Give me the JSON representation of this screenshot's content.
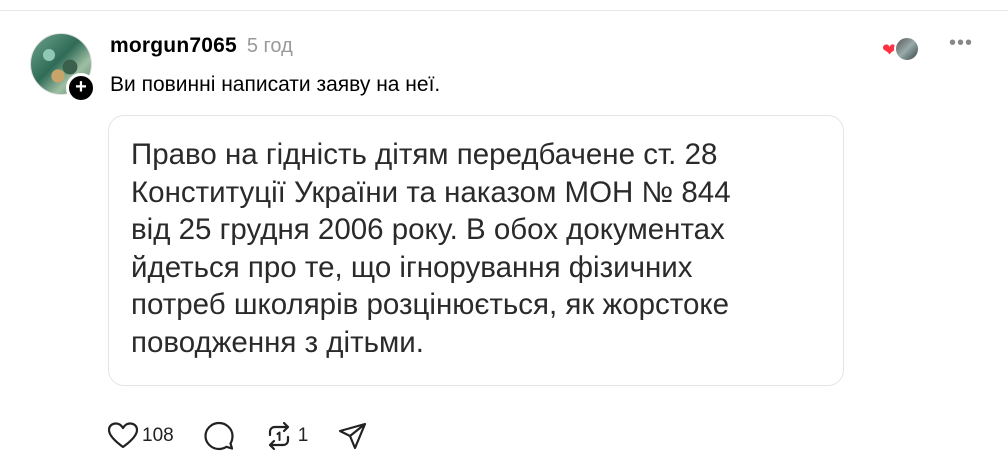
{
  "post": {
    "username": "morgun7065",
    "time": "5 год",
    "follow_symbol": "+",
    "comment": "Ви повинні написати заяву на неї.",
    "media_text": "Право на гідність дітям передбачене ст. 28\nКонституції України та наказом МОН № 844\nвід 25 грудня 2006 року. В обох документах\nйдеться про те, що ігнорування фізичних\nпотреб школярів розцінюється, як жорстоке\nповодження з дітьми."
  },
  "actions": {
    "like_count": "108",
    "repost_count": "1"
  },
  "colors": {
    "heart": "#ff3040",
    "muted": "#999999"
  },
  "icons": [
    "heart-icon",
    "comment-icon",
    "repost-icon",
    "share-icon",
    "more-icon"
  ]
}
